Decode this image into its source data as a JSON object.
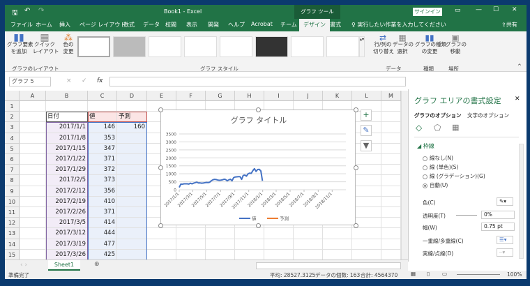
{
  "title_bar": {
    "title": "Book1 - Excel",
    "context_tab": "グラフ ツール",
    "signin": "サインイン"
  },
  "tabs": [
    "ファイル",
    "ホーム",
    "挿入",
    "ページ レイアウト",
    "数式",
    "データ",
    "校閲",
    "表示",
    "開発",
    "ヘルプ",
    "Acrobat",
    "チーム",
    "デザイン",
    "書式"
  ],
  "active_tab": "デザイン",
  "tell_me": "実行したい作業を入力してください",
  "share": "共有",
  "ribbon": {
    "add_element": "グラフ要素\nを追加",
    "quick_layout": "クイック\nレイアウト",
    "change_colors": "色の\n変更",
    "switch_row_col": "行/列の\n切り替え",
    "select_data": "データの\n選択",
    "change_type": "グラフの種類\nの変更",
    "move_chart": "グラフの\n移動",
    "groups": {
      "layout": "グラフのレイアウト",
      "styles": "グラフ スタイル",
      "data": "データ",
      "type": "種類",
      "location": "場所"
    }
  },
  "name_box": "グラフ 5",
  "formula_icons": {
    "cancel": "×",
    "enter": "✓",
    "fx": "fx"
  },
  "columns": [
    "A",
    "B",
    "C",
    "D",
    "E",
    "F",
    "G",
    "H",
    "I",
    "J",
    "K",
    "L",
    "M"
  ],
  "rows": [
    "1",
    "2",
    "3",
    "4",
    "5",
    "6",
    "7",
    "8",
    "9",
    "10",
    "11",
    "12",
    "13",
    "14",
    "15"
  ],
  "table": {
    "headers": [
      "日付",
      "値",
      "予測"
    ],
    "rows": [
      [
        "2017/1/1",
        "146",
        "160"
      ],
      [
        "2017/1/8",
        "353",
        ""
      ],
      [
        "2017/1/15",
        "347",
        ""
      ],
      [
        "2017/1/22",
        "371",
        ""
      ],
      [
        "2017/1/29",
        "372",
        ""
      ],
      [
        "2017/2/5",
        "373",
        ""
      ],
      [
        "2017/2/12",
        "356",
        ""
      ],
      [
        "2017/2/19",
        "410",
        ""
      ],
      [
        "2017/2/26",
        "371",
        ""
      ],
      [
        "2017/3/5",
        "414",
        ""
      ],
      [
        "2017/3/12",
        "444",
        ""
      ],
      [
        "2017/3/19",
        "477",
        ""
      ],
      [
        "2017/3/26",
        "425",
        ""
      ]
    ]
  },
  "chart_data": {
    "type": "line",
    "title": "グラフ タイトル",
    "x_start": "2017/1/1",
    "x_step_days": 7,
    "xlim": [
      "2017/1/1",
      "2018/12/31"
    ],
    "x_tick_labels": [
      "2017/1/1",
      "2017/3/1",
      "2017/5/1",
      "2017/7/1",
      "2017/9/1",
      "2017/11/1",
      "2018/1/1",
      "2018/3/1",
      "2018/5/1",
      "2018/7/1",
      "2018/9/1",
      "2018/11/1"
    ],
    "ylim": [
      0,
      3500
    ],
    "y_ticks": [
      "0",
      "500",
      "1000",
      "1500",
      "2000",
      "2500",
      "3000",
      "3500"
    ],
    "grid": true,
    "legend_position": "bottom",
    "series": [
      {
        "name": "値",
        "color": "#4472c4",
        "values": [
          146,
          353,
          347,
          371,
          372,
          373,
          356,
          410,
          371,
          414,
          444,
          477,
          425,
          430,
          410,
          420,
          440,
          460,
          450,
          470,
          560,
          620,
          650,
          640,
          610,
          590,
          600,
          620,
          660,
          640,
          560,
          620,
          660,
          560,
          760,
          800,
          810,
          820,
          820,
          650,
          900,
          920,
          850,
          1000,
          1040,
          1030,
          1200,
          1320,
          1150,
          1270,
          1280,
          1180,
          560
        ]
      },
      {
        "name": "予測",
        "color": "#ed7d31",
        "values": [
          160
        ]
      }
    ]
  },
  "pane": {
    "title": "グラフ エリアの書式設定",
    "tab_chart": "グラフのオプション",
    "tab_text": "文字のオプション",
    "section": "枠線",
    "radios": [
      "線なし(N)",
      "線 (単色)(S)",
      "線 (グラデーション)(G)",
      "自動(U)"
    ],
    "selected_radio": "自動(U)",
    "color_label": "色(C)",
    "transparency_label": "透明度(T)",
    "transparency": "0%",
    "width_label": "幅(W)",
    "width": "0.75 pt",
    "compound_label": "一重線/多重線(C)",
    "dash_label": "実線/点線(D)"
  },
  "sheet_tab": "Sheet1",
  "status": {
    "ready": "準備完了",
    "average": "平均: 28527.3125",
    "count": "データの個数: 163",
    "sum": "合計: 4564370",
    "zoom": "100%"
  }
}
